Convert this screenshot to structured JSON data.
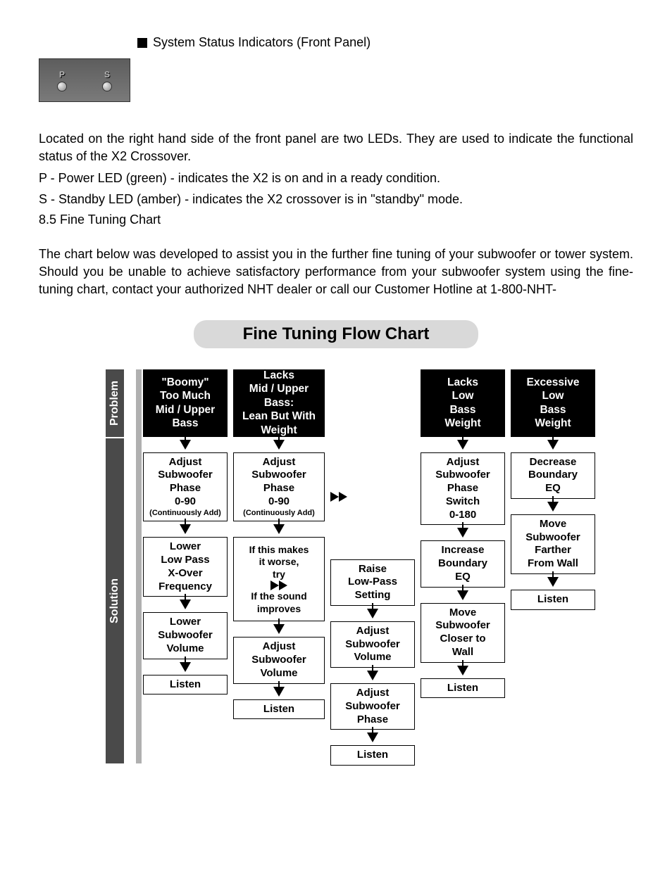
{
  "header": {
    "section_title": "System Status Indicators (Front Panel)"
  },
  "panel": {
    "led_p": "P",
    "led_s": "S"
  },
  "body": {
    "p1": "Located on the right hand side of the front panel are two LEDs.  They are used to indicate the functional status of the X2 Crossover.",
    "line_p": "P - Power LED (green) - indicates the X2 is on and in a ready condition.",
    "line_s": "S - Standby LED (amber) - indicates the X2 crossover is in \"standby\" mode.",
    "line_85": "8.5  Fine Tuning Chart",
    "p2": "The chart below was developed to assist you in the further fine tuning of your subwoofer or tower system.  Should you be unable to achieve satisfactory performance from your subwoofer system using the fine-tuning chart, contact your authorized NHT dealer or call our Customer Hotline at 1-800-NHT-"
  },
  "chart": {
    "title": "Fine Tuning Flow Chart",
    "side_problem": "Problem",
    "side_solution": "Solution",
    "col1": {
      "problem": "\"Boomy\"\nToo Much\nMid / Upper\nBass",
      "s1": "Adjust\nSubwoofer\nPhase\n0-90",
      "s1_sub": "(Continuously Add)",
      "s2": "Lower\nLow Pass\nX-Over\nFrequency",
      "s3": "Lower\nSubwoofer\nVolume",
      "s4": "Listen"
    },
    "col2": {
      "problem": "Lacks\nMid / Upper Bass:\nLean But With\nWeight",
      "s1": "Adjust\nSubwoofer\nPhase\n0-90",
      "s1_sub": "(Continuously Add)",
      "s2_a": "If this makes\nit worse,\ntry",
      "s2_b": "If the sound\nimproves",
      "s3": "Adjust\nSubwoofer\nVolume",
      "s4": "Listen"
    },
    "col2b": {
      "b1": "Raise\nLow-Pass\nSetting",
      "b2": "Adjust\nSubwoofer\nVolume",
      "b3": "Adjust\nSubwoofer\nPhase",
      "b4": "Listen"
    },
    "col3": {
      "problem": "Lacks\nLow\nBass\nWeight",
      "s1": "Adjust\nSubwoofer\nPhase\nSwitch\n0-180",
      "s2": "Increase\nBoundary\nEQ",
      "s3": "Move\nSubwoofer\nCloser to\nWall",
      "s4": "Listen"
    },
    "col4": {
      "problem": "Excessive\nLow\nBass\nWeight",
      "s1": "Decrease\nBoundary\nEQ",
      "s2": "Move\nSubwoofer\nFarther\nFrom Wall",
      "s3": "Listen"
    }
  }
}
